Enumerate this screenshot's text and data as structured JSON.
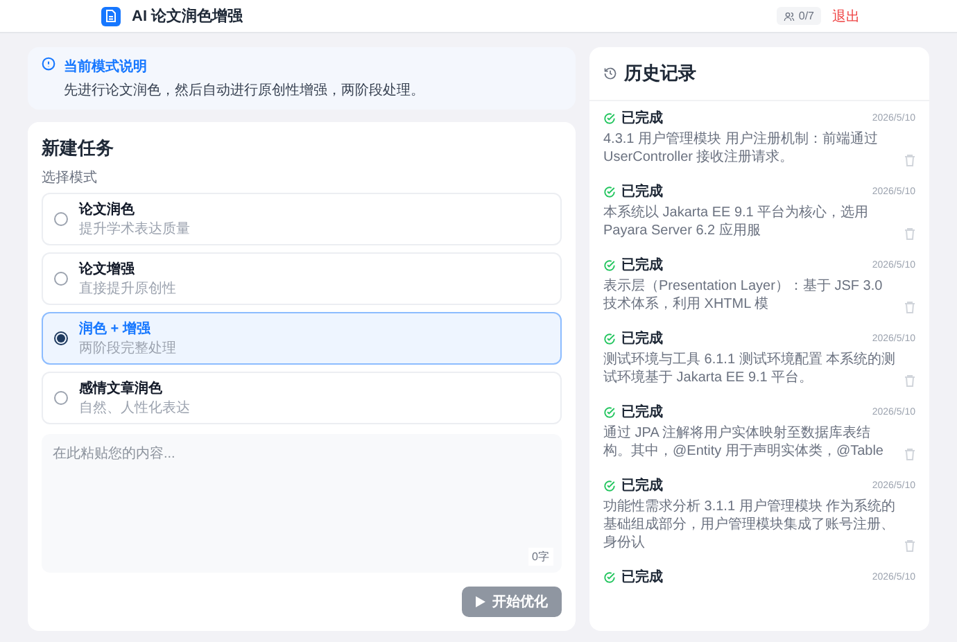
{
  "header": {
    "title": "AI 论文润色增强",
    "user_count": "0/7",
    "logout": "退出"
  },
  "mode_info": {
    "title": "当前模式说明",
    "text": "先进行论文润色，然后自动进行原创性增强，两阶段处理。"
  },
  "task": {
    "title": "新建任务",
    "mode_label": "选择模式",
    "modes": [
      {
        "title": "论文润色",
        "subtitle": "提升学术表达质量",
        "selected": false
      },
      {
        "title": "论文增强",
        "subtitle": "直接提升原创性",
        "selected": false
      },
      {
        "title": "润色 + 增强",
        "subtitle": "两阶段完整处理",
        "selected": true
      },
      {
        "title": "感情文章润色",
        "subtitle": "自然、人性化表达",
        "selected": false
      }
    ],
    "input": {
      "placeholder": "在此粘贴您的内容...",
      "counter": "0字"
    },
    "submit": {
      "label": "开始优化",
      "disabled": true
    }
  },
  "history": {
    "title": "历史记录",
    "items": [
      {
        "status": "已完成",
        "date": "2026/5/10",
        "text": "4.3.1 用户管理模块 用户注册机制：前端通过 UserController 接收注册请求。"
      },
      {
        "status": "已完成",
        "date": "2026/5/10",
        "text": "本系统以 Jakarta EE 9.1 平台为核心，选用 Payara Server 6.2 应用服"
      },
      {
        "status": "已完成",
        "date": "2026/5/10",
        "text": "表示层（Presentation Layer）：基于 JSF 3.0 技术体系，利用 XHTML 模"
      },
      {
        "status": "已完成",
        "date": "2026/5/10",
        "text": "测试环境与工具 6.1.1 测试环境配置 本系统的测试环境基于 Jakarta EE 9.1 平台。"
      },
      {
        "status": "已完成",
        "date": "2026/5/10",
        "text": "通过 JPA 注解将用户实体映射至数据库表结构。其中，@Entity 用于声明实体类，@Table"
      },
      {
        "status": "已完成",
        "date": "2026/5/10",
        "text": "功能性需求分析 3.1.1 用户管理模块 作为系统的基础组成部分，用户管理模块集成了账号注册、身份认"
      },
      {
        "status": "已完成",
        "date": "2026/5/10"
      }
    ]
  }
}
